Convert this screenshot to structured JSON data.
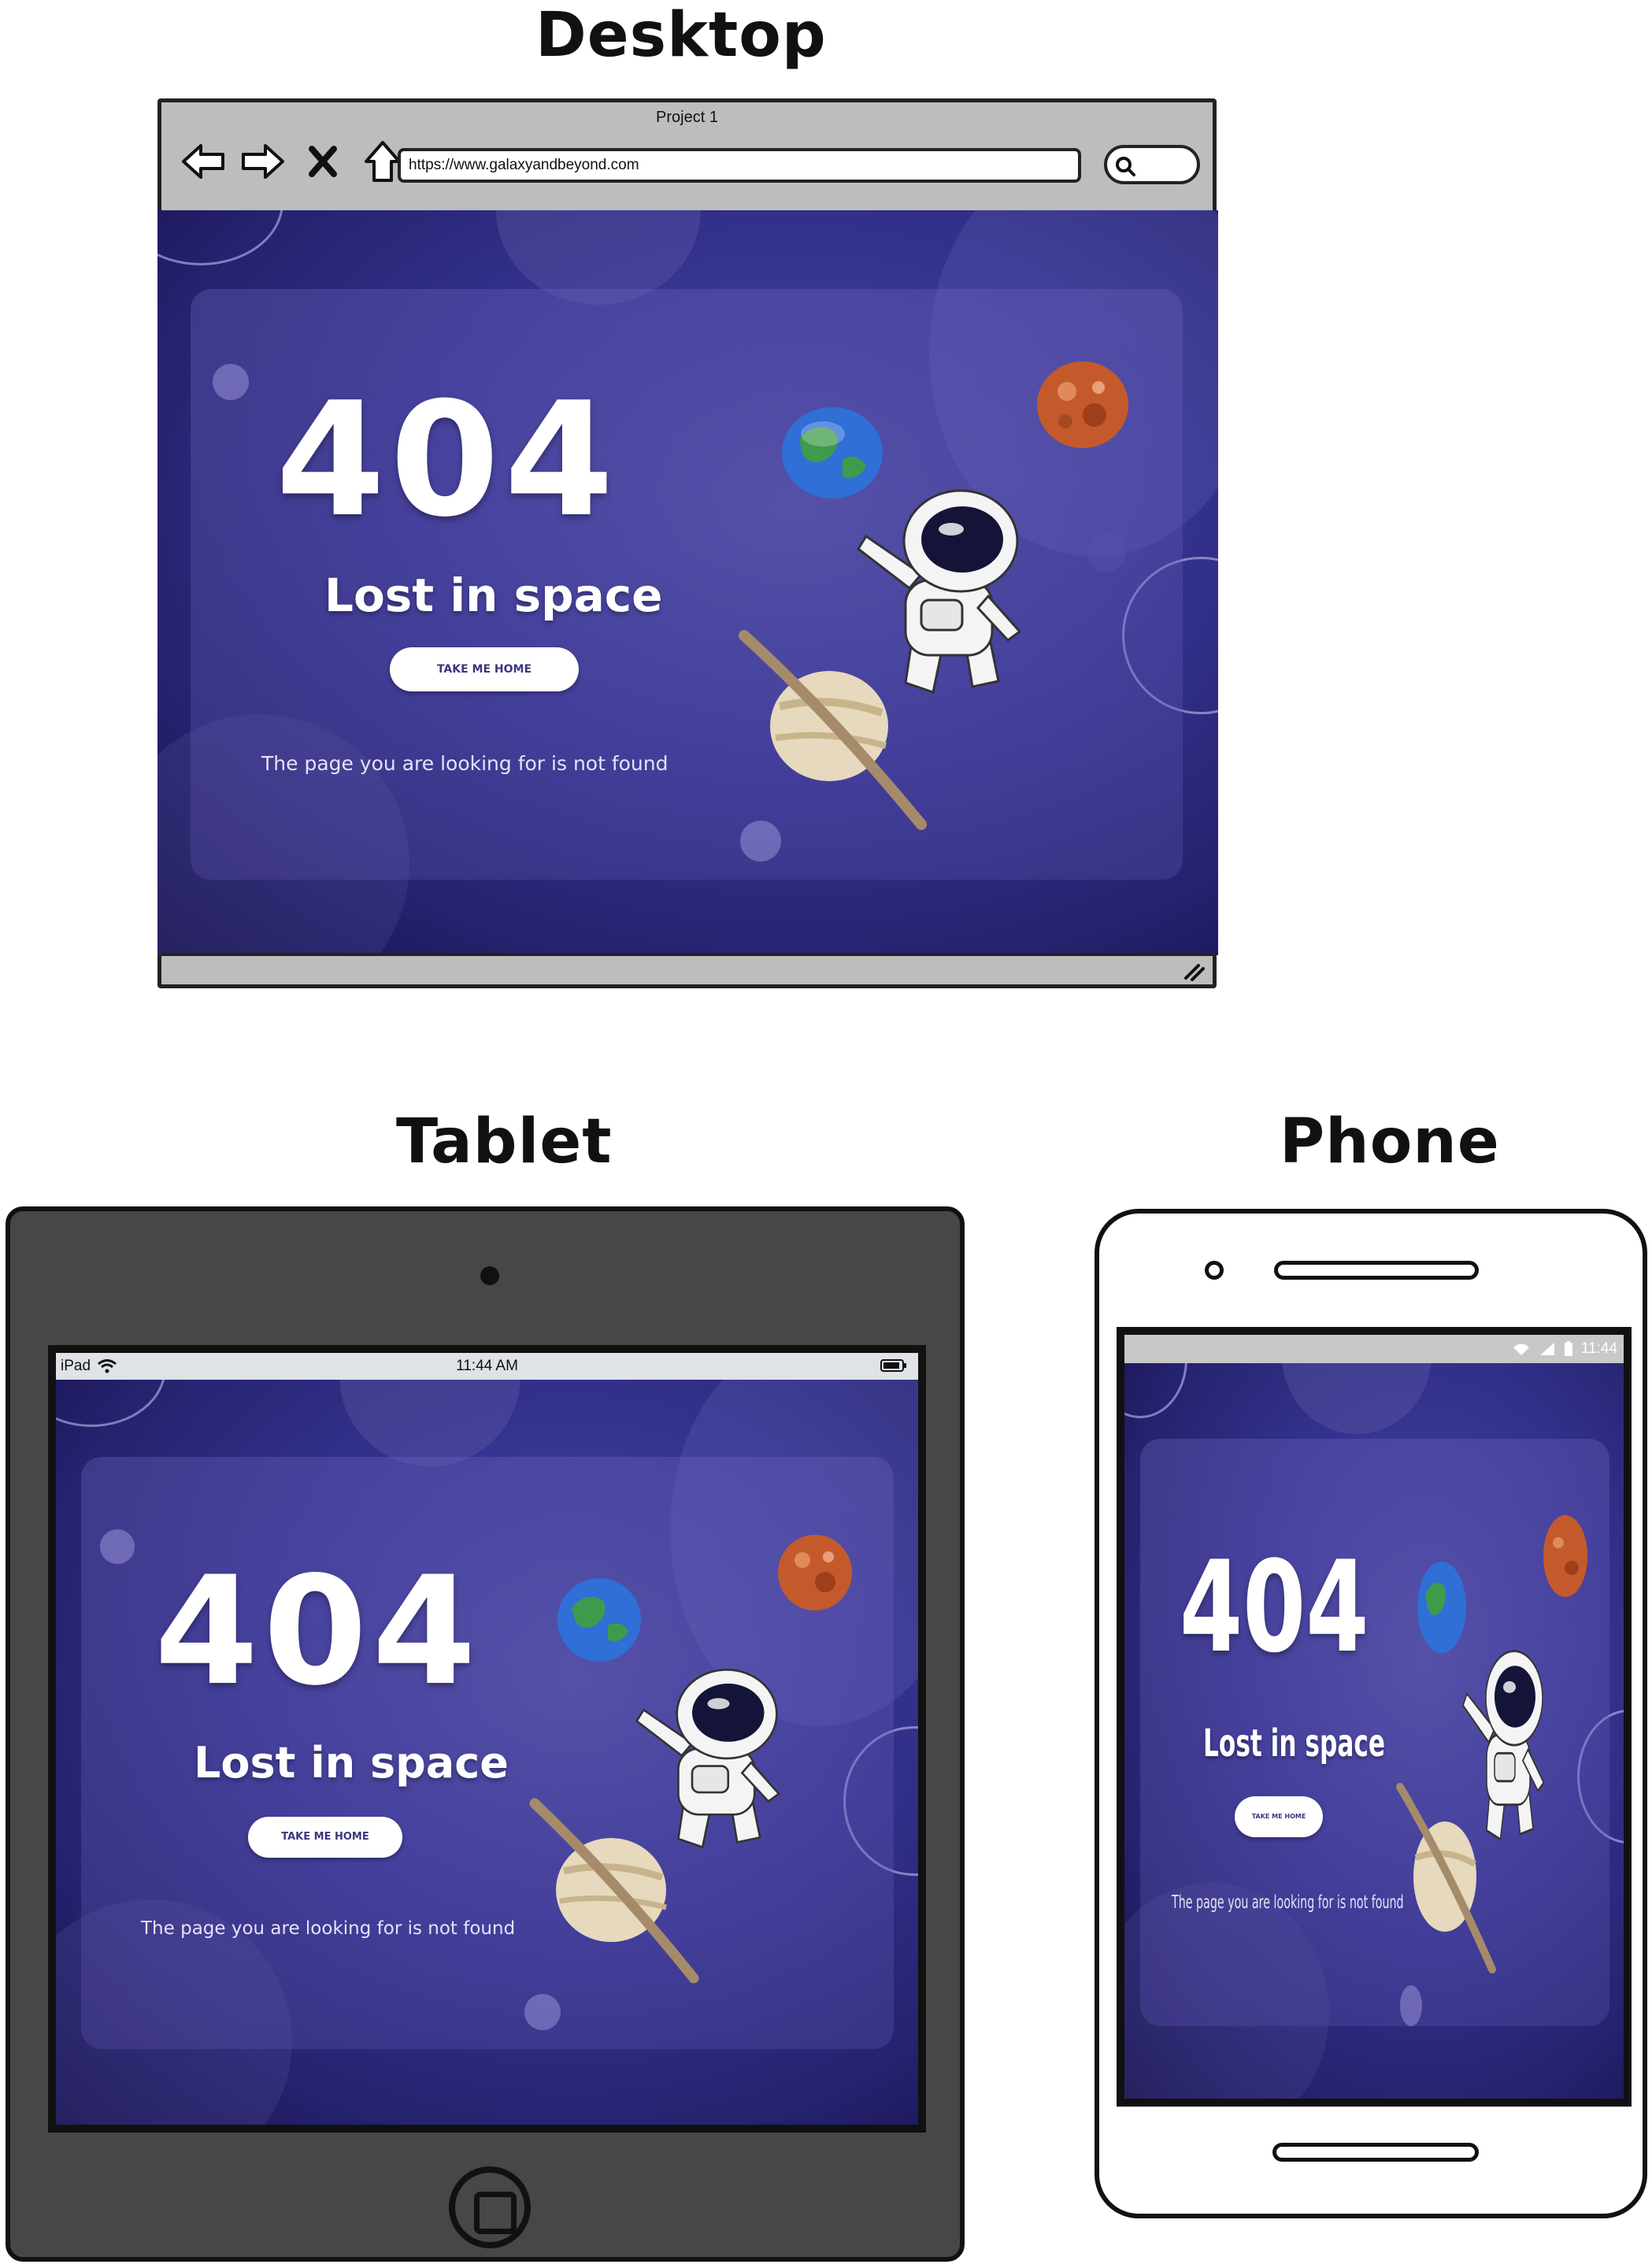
{
  "labels": {
    "desktop": "Desktop",
    "tablet": "Tablet",
    "phone": "Phone"
  },
  "browser": {
    "title": "Project 1",
    "url": "https://www.galaxyandbeyond.com",
    "nav_icons": [
      "back-arrow-icon",
      "forward-arrow-icon",
      "close-icon",
      "home-icon"
    ],
    "search_icon": "search-icon"
  },
  "page404": {
    "code": "404",
    "headline": "Lost in space",
    "button_label": "TAKE ME HOME",
    "message": "The page you are looking for is not found"
  },
  "tablet_status": {
    "device": "iPad",
    "time": "11:44 AM"
  },
  "phone_status": {
    "time": "11:44"
  },
  "colors": {
    "scene_bg": "#353390",
    "frame_gray": "#bdbdbd",
    "tablet_body": "#474747",
    "button_text": "#3a3780"
  }
}
